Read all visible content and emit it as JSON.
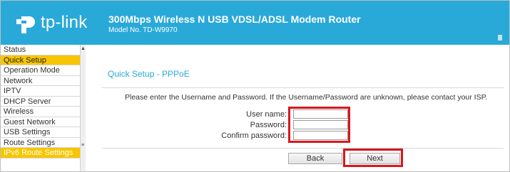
{
  "brand": {
    "logo_text": "tp-link",
    "logo_icon": "tp-link-logo-icon"
  },
  "header": {
    "title": "300Mbps Wireless N USB VDSL/ADSL Modem Router",
    "model": "Model No. TD-W9970"
  },
  "sidebar": {
    "items": [
      {
        "label": "Status"
      },
      {
        "label": "Quick Setup"
      },
      {
        "label": "Operation Mode"
      },
      {
        "label": "Network"
      },
      {
        "label": "IPTV"
      },
      {
        "label": "DHCP Server"
      },
      {
        "label": "Wireless"
      },
      {
        "label": "Guest Network"
      },
      {
        "label": "USB Settings"
      },
      {
        "label": "Route Settings"
      },
      {
        "label": "IPv6 Route Settings"
      }
    ],
    "scroll_up_icon": "▲",
    "scroll_thumb_icon": "≡"
  },
  "main": {
    "title": "Quick Setup - PPPoE",
    "instruction": "Please enter the Username and Password. If the Username/Password are unknown, please contact your ISP.",
    "fields": {
      "username": {
        "label": "User name:",
        "value": ""
      },
      "password": {
        "label": "Password:",
        "value": ""
      },
      "confirm": {
        "label": "Confirm password:",
        "value": ""
      }
    },
    "buttons": {
      "back": "Back",
      "next": "Next"
    }
  },
  "colors": {
    "header_bg": "#29a9d8",
    "sidebar_active": "#f7c600",
    "highlight_red": "#d9161c"
  }
}
